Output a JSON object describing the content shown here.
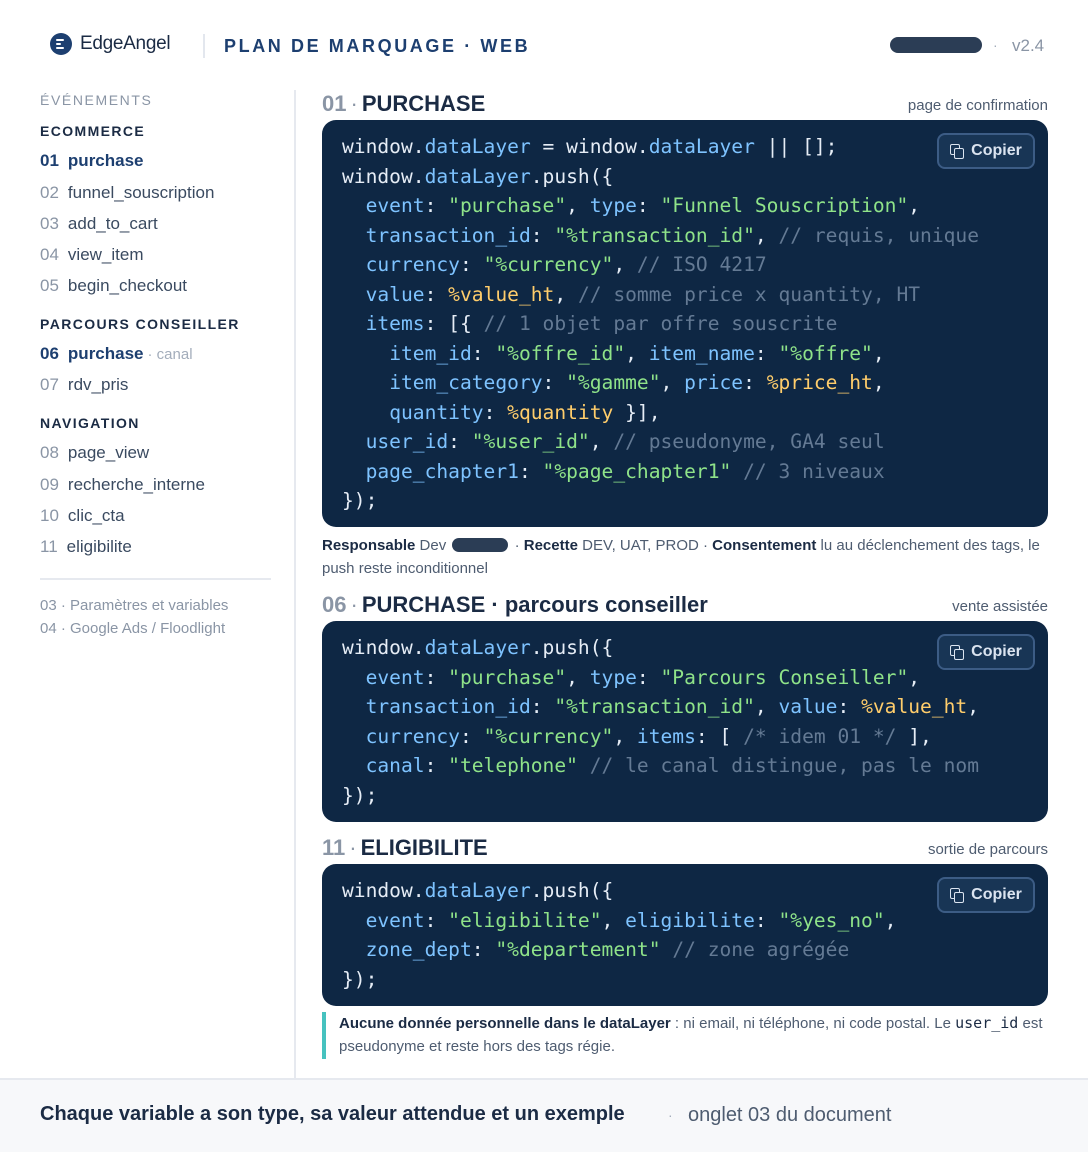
{
  "header": {
    "brand": "EdgeAngel",
    "title": "PLAN DE MARQUAGE · WEB",
    "separator": "·",
    "version": "v2.4"
  },
  "sidebar": {
    "heading": "ÉVÉNEMENTS",
    "groups": [
      {
        "label": "ECOMMERCE",
        "items": [
          {
            "num": "01",
            "label": "purchase",
            "active": true
          },
          {
            "num": "02",
            "label": "funnel_souscription"
          },
          {
            "num": "03",
            "label": "add_to_cart"
          },
          {
            "num": "04",
            "label": "view_item"
          },
          {
            "num": "05",
            "label": "begin_checkout"
          }
        ]
      },
      {
        "label": "PARCOURS CONSEILLER",
        "items": [
          {
            "num": "06",
            "label": "purchase",
            "extra": "· canal",
            "active": true
          },
          {
            "num": "07",
            "label": "rdv_pris"
          }
        ]
      },
      {
        "label": "NAVIGATION",
        "items": [
          {
            "num": "08",
            "label": "page_view"
          },
          {
            "num": "09",
            "label": "recherche_interne"
          },
          {
            "num": "10",
            "label": "clic_cta"
          },
          {
            "num": "11",
            "label": "eligibilite"
          }
        ]
      }
    ],
    "links": [
      "03 · Paramètres et variables",
      "04 · Google Ads / Floodlight"
    ]
  },
  "sections": [
    {
      "num": "01",
      "title": "PURCHASE",
      "note": "page de confirmation",
      "copy_label": "Copier"
    },
    {
      "num": "06",
      "title": "PURCHASE · parcours conseiller",
      "note": "vente assistée",
      "copy_label": "Copier"
    },
    {
      "num": "11",
      "title": "ELIGIBILITE",
      "note": "sortie de parcours",
      "copy_label": "Copier"
    }
  ],
  "code_blocks": [
    [
      [
        [
          "window.",
          ""
        ],
        [
          "dataLayer",
          "p"
        ],
        [
          " = window.",
          ""
        ],
        [
          "dataLayer",
          "p"
        ],
        [
          " || [];",
          ""
        ]
      ],
      [
        [
          "window.",
          ""
        ],
        [
          "dataLayer",
          "p"
        ],
        [
          ".push({",
          ""
        ]
      ],
      [
        [
          "  ",
          ""
        ],
        [
          "event",
          "p"
        ],
        [
          ": ",
          ""
        ],
        [
          "\"purchase\"",
          "s"
        ],
        [
          ", ",
          ""
        ],
        [
          "type",
          "p"
        ],
        [
          ": ",
          ""
        ],
        [
          "\"Funnel Souscription\"",
          "s"
        ],
        [
          ",",
          ""
        ]
      ],
      [
        [
          "  ",
          ""
        ],
        [
          "transaction_id",
          "p"
        ],
        [
          ": ",
          ""
        ],
        [
          "\"%transaction_id\"",
          "s"
        ],
        [
          ", ",
          ""
        ],
        [
          "// requis, unique",
          "c"
        ]
      ],
      [
        [
          "  ",
          ""
        ],
        [
          "currency",
          "p"
        ],
        [
          ": ",
          ""
        ],
        [
          "\"%currency\"",
          "s"
        ],
        [
          ", ",
          ""
        ],
        [
          "// ISO 4217",
          "c"
        ]
      ],
      [
        [
          "  ",
          ""
        ],
        [
          "value",
          "p"
        ],
        [
          ": ",
          ""
        ],
        [
          "%value_ht",
          "v"
        ],
        [
          ", ",
          ""
        ],
        [
          "// somme price x quantity, HT",
          "c"
        ]
      ],
      [
        [
          "  ",
          ""
        ],
        [
          "items",
          "p"
        ],
        [
          ": [{ ",
          ""
        ],
        [
          "// 1 objet par offre souscrite",
          "c"
        ]
      ],
      [
        [
          "    ",
          ""
        ],
        [
          "item_id",
          "p"
        ],
        [
          ": ",
          ""
        ],
        [
          "\"%offre_id\"",
          "s"
        ],
        [
          ", ",
          ""
        ],
        [
          "item_name",
          "p"
        ],
        [
          ": ",
          ""
        ],
        [
          "\"%offre\"",
          "s"
        ],
        [
          ",",
          ""
        ]
      ],
      [
        [
          "    ",
          ""
        ],
        [
          "item_category",
          "p"
        ],
        [
          ": ",
          ""
        ],
        [
          "\"%gamme\"",
          "s"
        ],
        [
          ", ",
          ""
        ],
        [
          "price",
          "p"
        ],
        [
          ": ",
          ""
        ],
        [
          "%price_ht",
          "v"
        ],
        [
          ",",
          ""
        ]
      ],
      [
        [
          "    ",
          ""
        ],
        [
          "quantity",
          "p"
        ],
        [
          ": ",
          ""
        ],
        [
          "%quantity",
          "v"
        ],
        [
          " }],",
          ""
        ]
      ],
      [
        [
          "  ",
          ""
        ],
        [
          "user_id",
          "p"
        ],
        [
          ": ",
          ""
        ],
        [
          "\"%user_id\"",
          "s"
        ],
        [
          ", ",
          ""
        ],
        [
          "// pseudonyme, GA4 seul",
          "c"
        ]
      ],
      [
        [
          "  ",
          ""
        ],
        [
          "page_chapter1",
          "p"
        ],
        [
          ": ",
          ""
        ],
        [
          "\"%page_chapter1\"",
          "s"
        ],
        [
          " ",
          ""
        ],
        [
          "// 3 niveaux",
          "c"
        ]
      ],
      [
        [
          "});",
          ""
        ]
      ]
    ],
    [
      [
        [
          "window.",
          ""
        ],
        [
          "dataLayer",
          "p"
        ],
        [
          ".push({",
          ""
        ]
      ],
      [
        [
          "  ",
          ""
        ],
        [
          "event",
          "p"
        ],
        [
          ": ",
          ""
        ],
        [
          "\"purchase\"",
          "s"
        ],
        [
          ", ",
          ""
        ],
        [
          "type",
          "p"
        ],
        [
          ": ",
          ""
        ],
        [
          "\"Parcours Conseiller\"",
          "s"
        ],
        [
          ",",
          ""
        ]
      ],
      [
        [
          "  ",
          ""
        ],
        [
          "transaction_id",
          "p"
        ],
        [
          ": ",
          ""
        ],
        [
          "\"%transaction_id\"",
          "s"
        ],
        [
          ", ",
          ""
        ],
        [
          "value",
          "p"
        ],
        [
          ": ",
          ""
        ],
        [
          "%value_ht",
          "v"
        ],
        [
          ",",
          ""
        ]
      ],
      [
        [
          "  ",
          ""
        ],
        [
          "currency",
          "p"
        ],
        [
          ": ",
          ""
        ],
        [
          "\"%currency\"",
          "s"
        ],
        [
          ", ",
          ""
        ],
        [
          "items",
          "p"
        ],
        [
          ": [ ",
          ""
        ],
        [
          "/* idem 01 */",
          "c"
        ],
        [
          " ],",
          ""
        ]
      ],
      [
        [
          "  ",
          ""
        ],
        [
          "canal",
          "p"
        ],
        [
          ": ",
          ""
        ],
        [
          "\"telephone\"",
          "s"
        ],
        [
          " ",
          ""
        ],
        [
          "// le canal distingue, pas le nom",
          "c"
        ]
      ],
      [
        [
          "});",
          ""
        ]
      ]
    ],
    [
      [
        [
          "window.",
          ""
        ],
        [
          "dataLayer",
          "p"
        ],
        [
          ".push({",
          ""
        ]
      ],
      [
        [
          "  ",
          ""
        ],
        [
          "event",
          "p"
        ],
        [
          ": ",
          ""
        ],
        [
          "\"eligibilite\"",
          "s"
        ],
        [
          ", ",
          ""
        ],
        [
          "eligibilite",
          "p"
        ],
        [
          ": ",
          ""
        ],
        [
          "\"%yes_no\"",
          "s"
        ],
        [
          ",",
          ""
        ]
      ],
      [
        [
          "  ",
          ""
        ],
        [
          "zone_dept",
          "p"
        ],
        [
          ": ",
          ""
        ],
        [
          "\"%departement\"",
          "s"
        ],
        [
          " ",
          ""
        ],
        [
          "// zone agrégée",
          "c"
        ]
      ],
      [
        [
          "});",
          ""
        ]
      ]
    ]
  ],
  "meta": {
    "owner_label": "Responsable",
    "owner_value": "Dev",
    "sep": "·",
    "recette_label": "Recette",
    "recette_value": "DEV, UAT, PROD",
    "consent_label": "Consentement",
    "consent_value": "lu au déclenchement des tags, le push reste inconditionnel"
  },
  "callout": {
    "bold": "Aucune donnée personnelle dans le dataLayer",
    "text1": " : ni email, ni téléphone, ni code postal. Le ",
    "code": "user_id",
    "text2": " est pseudonyme et reste hors des tags régie."
  },
  "footer": {
    "title": "Chaque variable a son type, sa valeur attendue et un exemple",
    "separator": "·",
    "note": "onglet 03 du document"
  },
  "colors": {
    "navy": "#1d3f70",
    "code_bg": "#0e2744",
    "code_property": "#7ec3ff",
    "code_string": "#8fe389",
    "code_variable": "#ffcd6b",
    "code_comment": "#647a94",
    "callout_accent": "#46c2bf"
  }
}
